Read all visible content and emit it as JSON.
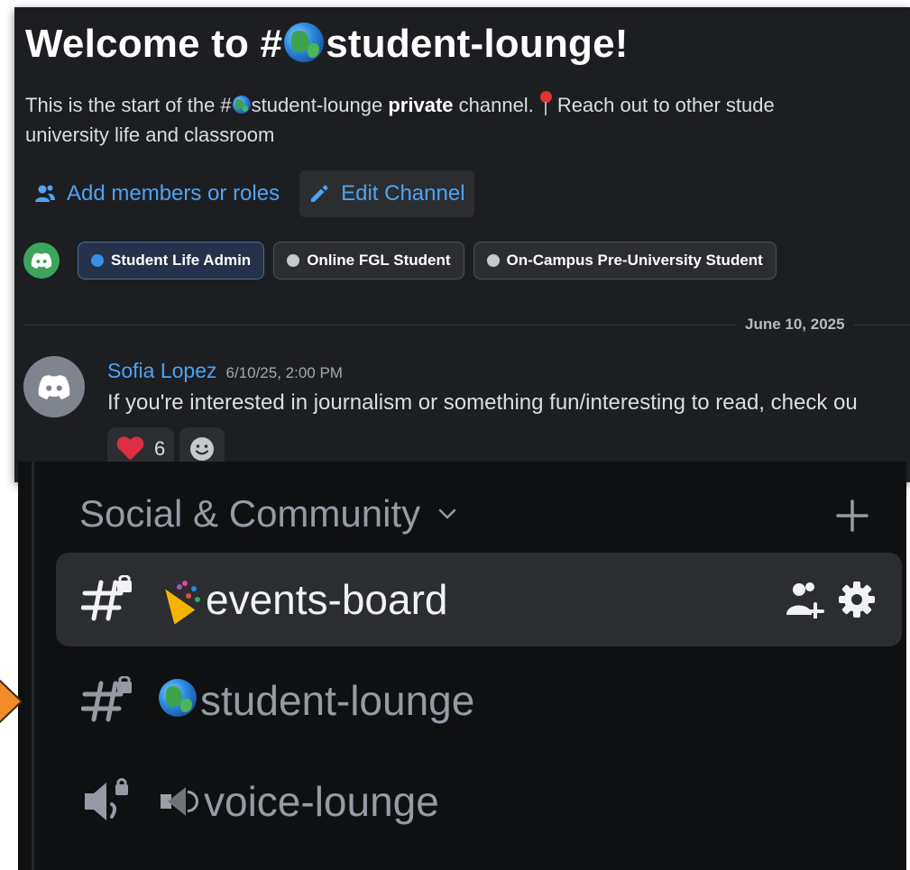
{
  "channel_intro": {
    "title_prefix": "Welcome to #",
    "title_channel": "student-lounge!",
    "intro_prefix": "This is the start of the #",
    "intro_channel": "student-lounge",
    "intro_private": "private",
    "intro_mid": " channel.",
    "intro_tail": "Reach out to other stude",
    "intro_line2": "university life and classroom",
    "add_members_label": "Add members or roles",
    "edit_channel_label": "Edit Channel"
  },
  "roles": [
    {
      "label": "Student Life Admin",
      "dot_color": "#3a8ee6"
    },
    {
      "label": "Online FGL Student",
      "dot_color": "#c4c9ce"
    },
    {
      "label": "On-Campus Pre-University Student",
      "dot_color": "#c4c9ce"
    }
  ],
  "date_divider": "June 10, 2025",
  "message": {
    "author": "Sofia Lopez",
    "timestamp": "6/10/25, 2:00 PM",
    "text": "If you're interested in journalism or something fun/interesting to read, check ou",
    "reaction_count": "6"
  },
  "sidebar": {
    "category": "Social & Community",
    "channels": [
      {
        "name": "events-board",
        "type": "text-locked",
        "emoji": "party-popper"
      },
      {
        "name": "student-lounge",
        "type": "text-locked",
        "emoji": "globe"
      },
      {
        "name": "voice-lounge",
        "type": "voice-locked",
        "emoji": "speaker"
      }
    ]
  },
  "colors": {
    "link_blue": "#4ea3f2",
    "panel_dark": "#1d1e22",
    "sidebar_dark": "#0f1012",
    "arrow_orange": "#f28c28",
    "bot_green": "#3ba55c"
  }
}
